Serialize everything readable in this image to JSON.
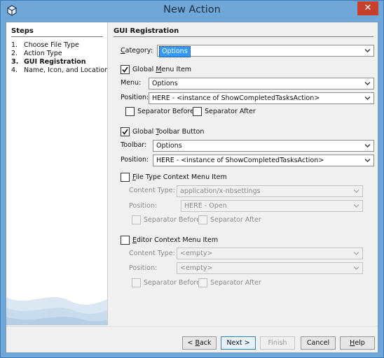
{
  "window": {
    "title": "New Action",
    "close_glyph": "✕"
  },
  "steps": {
    "title": "Steps",
    "items": [
      {
        "num": "1.",
        "label": "Choose File Type"
      },
      {
        "num": "2.",
        "label": "Action Type"
      },
      {
        "num": "3.",
        "label": "GUI Registration",
        "current": true
      },
      {
        "num": "4.",
        "label": "Name, Icon, and Location"
      }
    ]
  },
  "panel": {
    "title": "GUI Registration",
    "category": {
      "label": "Category:",
      "value": "Options"
    },
    "global_menu": {
      "checkbox_label": "Global Menu Item",
      "checked": true,
      "menu_label": "Menu:",
      "menu_value": "Options",
      "position_label": "Position:",
      "position_value": "HERE - <instance of ShowCompletedTasksAction>",
      "separator_before": "Separator Before",
      "separator_after": "Separator After"
    },
    "global_toolbar": {
      "checkbox_label": "Global Toolbar Button",
      "checked": true,
      "toolbar_label": "Toolbar:",
      "toolbar_value": "Options",
      "position_label": "Position:",
      "position_value": "HERE - <instance of ShowCompletedTasksAction>"
    },
    "file_type_context": {
      "checkbox_label": "File Type Context Menu Item",
      "checked": false,
      "content_type_label": "Content Type:",
      "content_type_value": "application/x-nbsettings",
      "position_label": "Position:",
      "position_value": "HERE - Open",
      "separator_before": "Separator Before",
      "separator_after": "Separator After"
    },
    "editor_context": {
      "checkbox_label": "Editor Context Menu Item",
      "checked": false,
      "content_type_label": "Content Type:",
      "content_type_value": "<empty>",
      "position_label": "Position:",
      "position_value": "<empty>",
      "separator_before": "Separator Before",
      "separator_after": "Separator After"
    }
  },
  "buttons": {
    "back": "< Back",
    "next": "Next >",
    "finish": "Finish",
    "cancel": "Cancel",
    "help": "Help"
  },
  "colors": {
    "title_bar": "#6fa7d8",
    "close_button": "#c7402d",
    "selection": "#3399ff",
    "default_button": "#3c7fb1"
  }
}
